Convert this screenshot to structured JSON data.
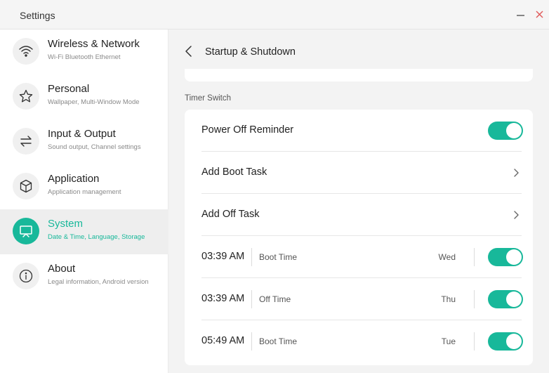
{
  "window": {
    "title": "Settings"
  },
  "colors": {
    "accent": "#18b89a",
    "close": "#e05a5a"
  },
  "sidebar": {
    "items": [
      {
        "title": "Wireless & Network",
        "subtitle": "Wi-Fi Bluetooth Ethernet",
        "icon": "wifi-icon",
        "active": false
      },
      {
        "title": "Personal",
        "subtitle": "Wallpaper, Multi-Window Mode",
        "icon": "star-icon",
        "active": false
      },
      {
        "title": "Input & Output",
        "subtitle": "Sound output, Channel settings",
        "icon": "swap-arrows-icon",
        "active": false
      },
      {
        "title": "Application",
        "subtitle": "Application management",
        "icon": "cube-icon",
        "active": false
      },
      {
        "title": "System",
        "subtitle": "Date & Time, Language, Storage",
        "icon": "monitor-icon",
        "active": true
      },
      {
        "title": "About",
        "subtitle": "Legal information, Android version",
        "icon": "info-icon",
        "active": false
      }
    ]
  },
  "main": {
    "page_title": "Startup & Shutdown",
    "section_label": "Timer Switch",
    "power_off_reminder": {
      "label": "Power Off Reminder",
      "on": true
    },
    "add_boot_task": "Add Boot Task",
    "add_off_task": "Add Off Task",
    "tasks": [
      {
        "time": "03:39 AM",
        "type": "Boot Time",
        "day": "Wed",
        "on": true
      },
      {
        "time": "03:39 AM",
        "type": "Off Time",
        "day": "Thu",
        "on": true
      },
      {
        "time": "05:49 AM",
        "type": "Boot Time",
        "day": "Tue",
        "on": true
      }
    ]
  }
}
